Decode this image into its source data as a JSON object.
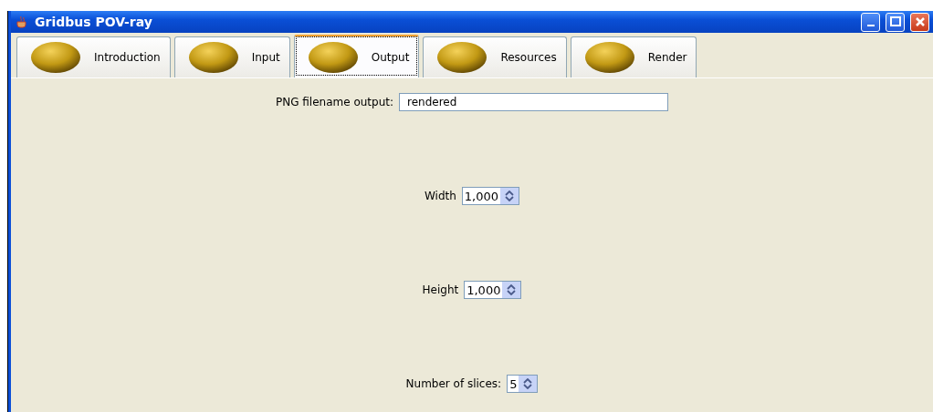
{
  "window": {
    "title": "Gridbus POV-ray"
  },
  "tabs": [
    {
      "label": "Introduction",
      "selected": false
    },
    {
      "label": "Input",
      "selected": false
    },
    {
      "label": "Output",
      "selected": true
    },
    {
      "label": "Resources",
      "selected": false
    },
    {
      "label": "Render",
      "selected": false
    }
  ],
  "fields": [
    {
      "kind": "text",
      "label": "PNG filename output:",
      "value": "rendered"
    },
    {
      "kind": "spinner",
      "label": "Width",
      "value": "1,000"
    },
    {
      "kind": "spinner",
      "label": "Height",
      "value": "1,000"
    },
    {
      "kind": "spinner",
      "label": "Number of slices:",
      "value": "5"
    }
  ]
}
